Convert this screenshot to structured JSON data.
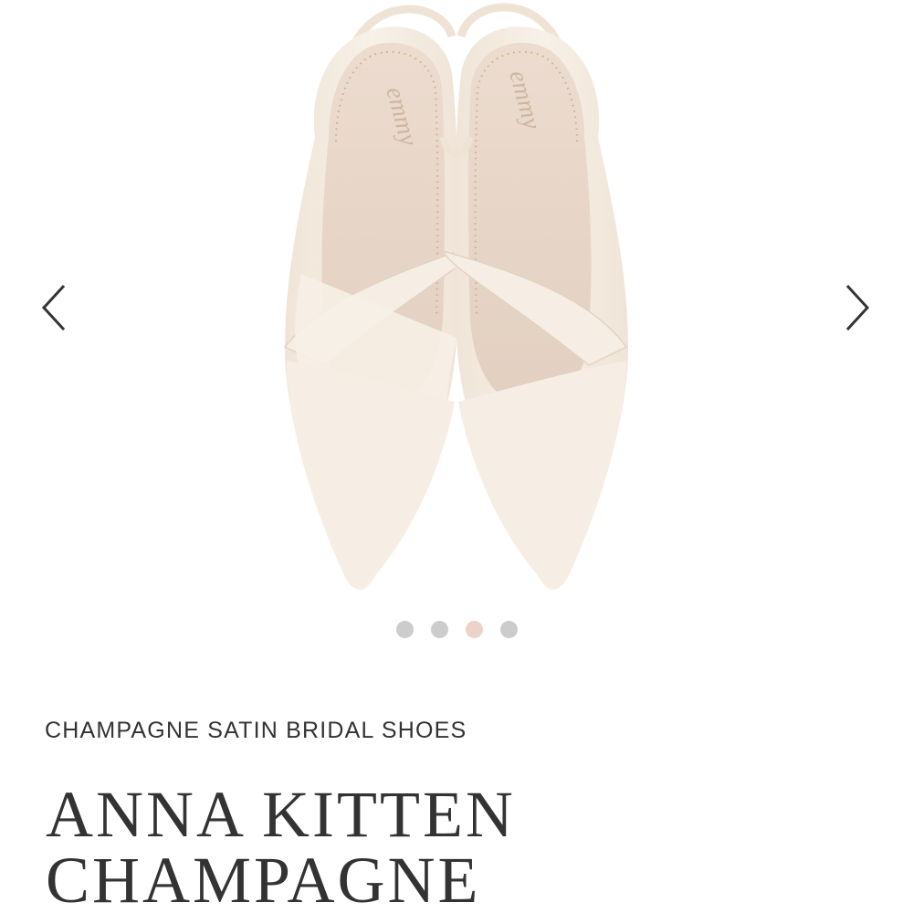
{
  "gallery": {
    "image_alt": "Product image of ivory pointed kitten heel slingback bridal shoes",
    "brand_mark": "emmy",
    "prev_icon": "chevron-left-icon",
    "next_icon": "chevron-right-icon",
    "dots": [
      {
        "state": "inactive",
        "color": "#cccccc"
      },
      {
        "state": "inactive",
        "color": "#cccccc"
      },
      {
        "state": "active",
        "color": "#ecd3c9"
      },
      {
        "state": "inactive",
        "color": "#cccccc"
      }
    ],
    "active_slide": 3,
    "slide_count": 4
  },
  "product": {
    "subtitle": "CHAMPAGNE SATIN BRIDAL SHOES",
    "title_line1": "ANNA KITTEN",
    "title_line2": "CHAMPAGNE"
  },
  "colors": {
    "text": "#333333",
    "shoe": "#f4ece2",
    "insole": "#ead9cb",
    "dot_active": "#ecd3c9",
    "dot_inactive": "#cccccc"
  }
}
